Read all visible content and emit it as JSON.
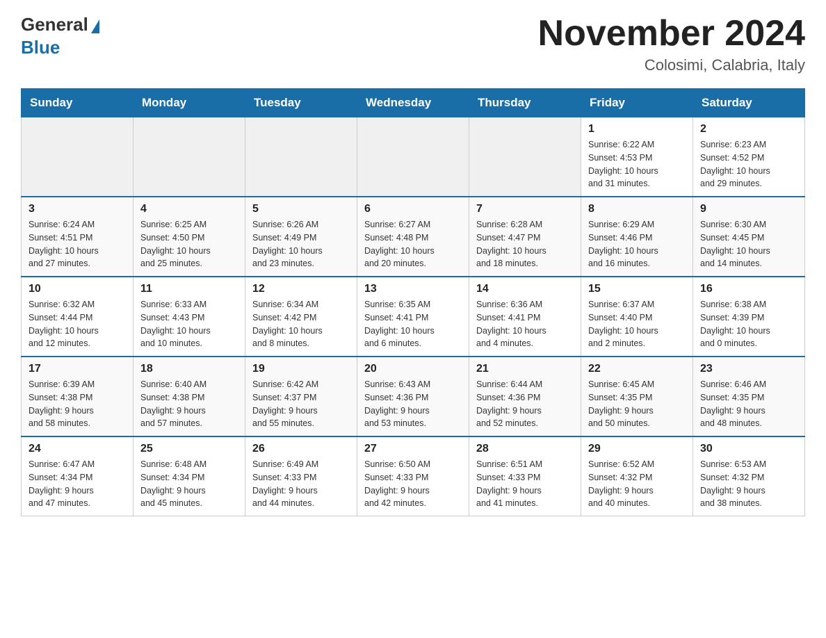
{
  "header": {
    "logo_general": "General",
    "logo_blue": "Blue",
    "month_title": "November 2024",
    "location": "Colosimi, Calabria, Italy"
  },
  "days_of_week": [
    "Sunday",
    "Monday",
    "Tuesday",
    "Wednesday",
    "Thursday",
    "Friday",
    "Saturday"
  ],
  "weeks": [
    [
      {
        "day": "",
        "info": ""
      },
      {
        "day": "",
        "info": ""
      },
      {
        "day": "",
        "info": ""
      },
      {
        "day": "",
        "info": ""
      },
      {
        "day": "",
        "info": ""
      },
      {
        "day": "1",
        "info": "Sunrise: 6:22 AM\nSunset: 4:53 PM\nDaylight: 10 hours\nand 31 minutes."
      },
      {
        "day": "2",
        "info": "Sunrise: 6:23 AM\nSunset: 4:52 PM\nDaylight: 10 hours\nand 29 minutes."
      }
    ],
    [
      {
        "day": "3",
        "info": "Sunrise: 6:24 AM\nSunset: 4:51 PM\nDaylight: 10 hours\nand 27 minutes."
      },
      {
        "day": "4",
        "info": "Sunrise: 6:25 AM\nSunset: 4:50 PM\nDaylight: 10 hours\nand 25 minutes."
      },
      {
        "day": "5",
        "info": "Sunrise: 6:26 AM\nSunset: 4:49 PM\nDaylight: 10 hours\nand 23 minutes."
      },
      {
        "day": "6",
        "info": "Sunrise: 6:27 AM\nSunset: 4:48 PM\nDaylight: 10 hours\nand 20 minutes."
      },
      {
        "day": "7",
        "info": "Sunrise: 6:28 AM\nSunset: 4:47 PM\nDaylight: 10 hours\nand 18 minutes."
      },
      {
        "day": "8",
        "info": "Sunrise: 6:29 AM\nSunset: 4:46 PM\nDaylight: 10 hours\nand 16 minutes."
      },
      {
        "day": "9",
        "info": "Sunrise: 6:30 AM\nSunset: 4:45 PM\nDaylight: 10 hours\nand 14 minutes."
      }
    ],
    [
      {
        "day": "10",
        "info": "Sunrise: 6:32 AM\nSunset: 4:44 PM\nDaylight: 10 hours\nand 12 minutes."
      },
      {
        "day": "11",
        "info": "Sunrise: 6:33 AM\nSunset: 4:43 PM\nDaylight: 10 hours\nand 10 minutes."
      },
      {
        "day": "12",
        "info": "Sunrise: 6:34 AM\nSunset: 4:42 PM\nDaylight: 10 hours\nand 8 minutes."
      },
      {
        "day": "13",
        "info": "Sunrise: 6:35 AM\nSunset: 4:41 PM\nDaylight: 10 hours\nand 6 minutes."
      },
      {
        "day": "14",
        "info": "Sunrise: 6:36 AM\nSunset: 4:41 PM\nDaylight: 10 hours\nand 4 minutes."
      },
      {
        "day": "15",
        "info": "Sunrise: 6:37 AM\nSunset: 4:40 PM\nDaylight: 10 hours\nand 2 minutes."
      },
      {
        "day": "16",
        "info": "Sunrise: 6:38 AM\nSunset: 4:39 PM\nDaylight: 10 hours\nand 0 minutes."
      }
    ],
    [
      {
        "day": "17",
        "info": "Sunrise: 6:39 AM\nSunset: 4:38 PM\nDaylight: 9 hours\nand 58 minutes."
      },
      {
        "day": "18",
        "info": "Sunrise: 6:40 AM\nSunset: 4:38 PM\nDaylight: 9 hours\nand 57 minutes."
      },
      {
        "day": "19",
        "info": "Sunrise: 6:42 AM\nSunset: 4:37 PM\nDaylight: 9 hours\nand 55 minutes."
      },
      {
        "day": "20",
        "info": "Sunrise: 6:43 AM\nSunset: 4:36 PM\nDaylight: 9 hours\nand 53 minutes."
      },
      {
        "day": "21",
        "info": "Sunrise: 6:44 AM\nSunset: 4:36 PM\nDaylight: 9 hours\nand 52 minutes."
      },
      {
        "day": "22",
        "info": "Sunrise: 6:45 AM\nSunset: 4:35 PM\nDaylight: 9 hours\nand 50 minutes."
      },
      {
        "day": "23",
        "info": "Sunrise: 6:46 AM\nSunset: 4:35 PM\nDaylight: 9 hours\nand 48 minutes."
      }
    ],
    [
      {
        "day": "24",
        "info": "Sunrise: 6:47 AM\nSunset: 4:34 PM\nDaylight: 9 hours\nand 47 minutes."
      },
      {
        "day": "25",
        "info": "Sunrise: 6:48 AM\nSunset: 4:34 PM\nDaylight: 9 hours\nand 45 minutes."
      },
      {
        "day": "26",
        "info": "Sunrise: 6:49 AM\nSunset: 4:33 PM\nDaylight: 9 hours\nand 44 minutes."
      },
      {
        "day": "27",
        "info": "Sunrise: 6:50 AM\nSunset: 4:33 PM\nDaylight: 9 hours\nand 42 minutes."
      },
      {
        "day": "28",
        "info": "Sunrise: 6:51 AM\nSunset: 4:33 PM\nDaylight: 9 hours\nand 41 minutes."
      },
      {
        "day": "29",
        "info": "Sunrise: 6:52 AM\nSunset: 4:32 PM\nDaylight: 9 hours\nand 40 minutes."
      },
      {
        "day": "30",
        "info": "Sunrise: 6:53 AM\nSunset: 4:32 PM\nDaylight: 9 hours\nand 38 minutes."
      }
    ]
  ]
}
